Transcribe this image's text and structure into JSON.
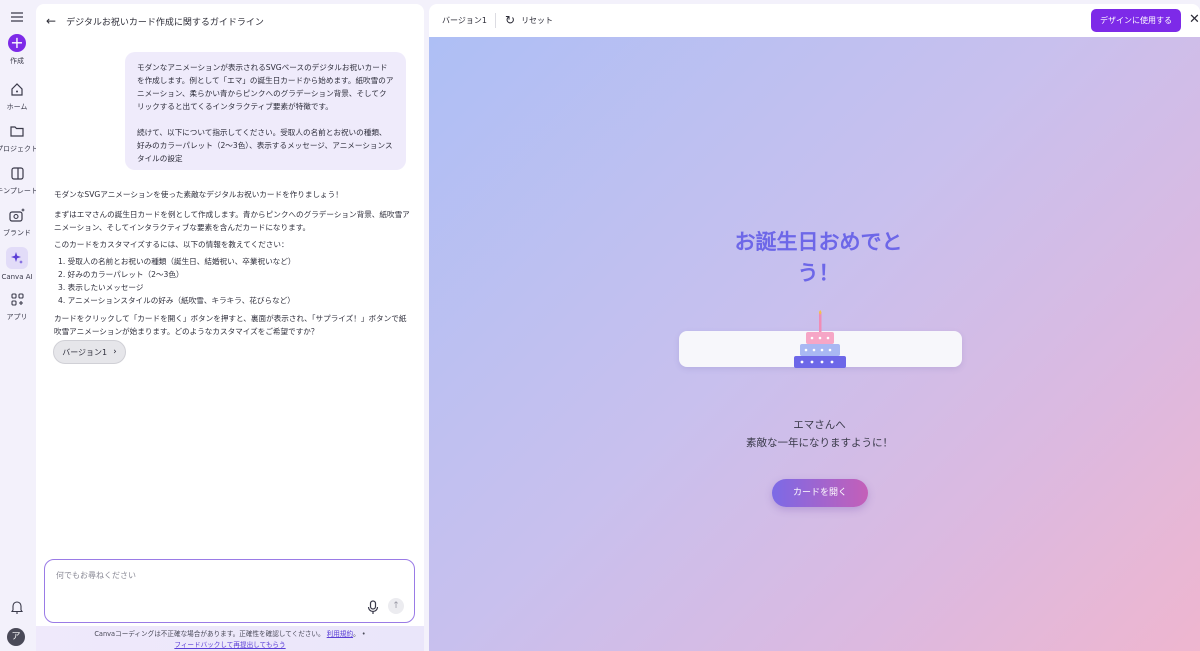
{
  "rail": {
    "create_label": "作成",
    "items": [
      {
        "label": "ホーム",
        "icon": "home-icon"
      },
      {
        "label": "プロジェクト",
        "icon": "folder-icon"
      },
      {
        "label": "テンプレート",
        "icon": "template-icon"
      },
      {
        "label": "ブランド",
        "icon": "brand-icon"
      },
      {
        "label": "Canva AI",
        "icon": "sparkle-icon"
      },
      {
        "label": "アプリ",
        "icon": "apps-icon"
      }
    ],
    "avatar_initial": "ア"
  },
  "chat": {
    "header_title": "デジタルお祝いカード作成に関するガイドライン",
    "user_message_p1": "モダンなアニメーションが表示されるSVGベースのデジタルお祝いカードを作成します。例として「エマ」の誕生日カードから始めます。紙吹雪のアニメーション、柔らかい青からピンクへのグラデーション背景、そしてクリックすると出てくるインタラクティブ要素が特徴です。",
    "user_message_p2": "続けて、以下について指示してください。受取人の名前とお祝いの種類、好みのカラーパレット（2〜3色）、表示するメッセージ、アニメーションスタイルの設定",
    "assistant_intro": "モダンなSVGアニメーションを使った素敵なデジタルお祝いカードを作りましょう！",
    "assistant_p1": "まずはエマさんの誕生日カードを例として作成します。青からピンクへのグラデーション背景、紙吹雪アニメーション、そしてインタラクティブな要素を含んだカードになります。",
    "assistant_p2": "このカードをカスタマイズするには、以下の情報を教えてください：",
    "assistant_list": [
      "1. 受取人の名前とお祝いの種類（誕生日、結婚祝い、卒業祝いなど）",
      "2. 好みのカラーパレット（2〜3色）",
      "3. 表示したいメッセージ",
      "4. アニメーションスタイルの好み（紙吹雪、キラキラ、花びらなど）"
    ],
    "assistant_p3": "カードをクリックして「カードを開く」ボタンを押すと、裏面が表示され、「サプライズ！」ボタンで紙吹雪アニメーションが始まります。どのようなカスタマイズをご希望ですか？",
    "version_chip": "バージョン1",
    "input_placeholder": "何でもお尋ねください",
    "footer_text": "Canvaコーディングは不正確な場合があります。正確性を確認してください。",
    "footer_link_terms": "利用規約",
    "footer_sep": "。 •",
    "footer_link_feedback": "フィードバックして再提出してもらう"
  },
  "preview": {
    "version_label": "バージョン1",
    "reset_label": "リセット",
    "use_design_label": "デザインに使用する",
    "card_title_line1": "お誕生日おめでと",
    "card_title_line2": "う！",
    "message_to": "エマさんへ",
    "message_body": "素敵な一年になりますように！",
    "open_button": "カードを開く"
  },
  "colors": {
    "accent": "#7d2ae8",
    "title": "#6d67e8",
    "gradient_start": "#aebff5",
    "gradient_end": "#efb6cf"
  }
}
